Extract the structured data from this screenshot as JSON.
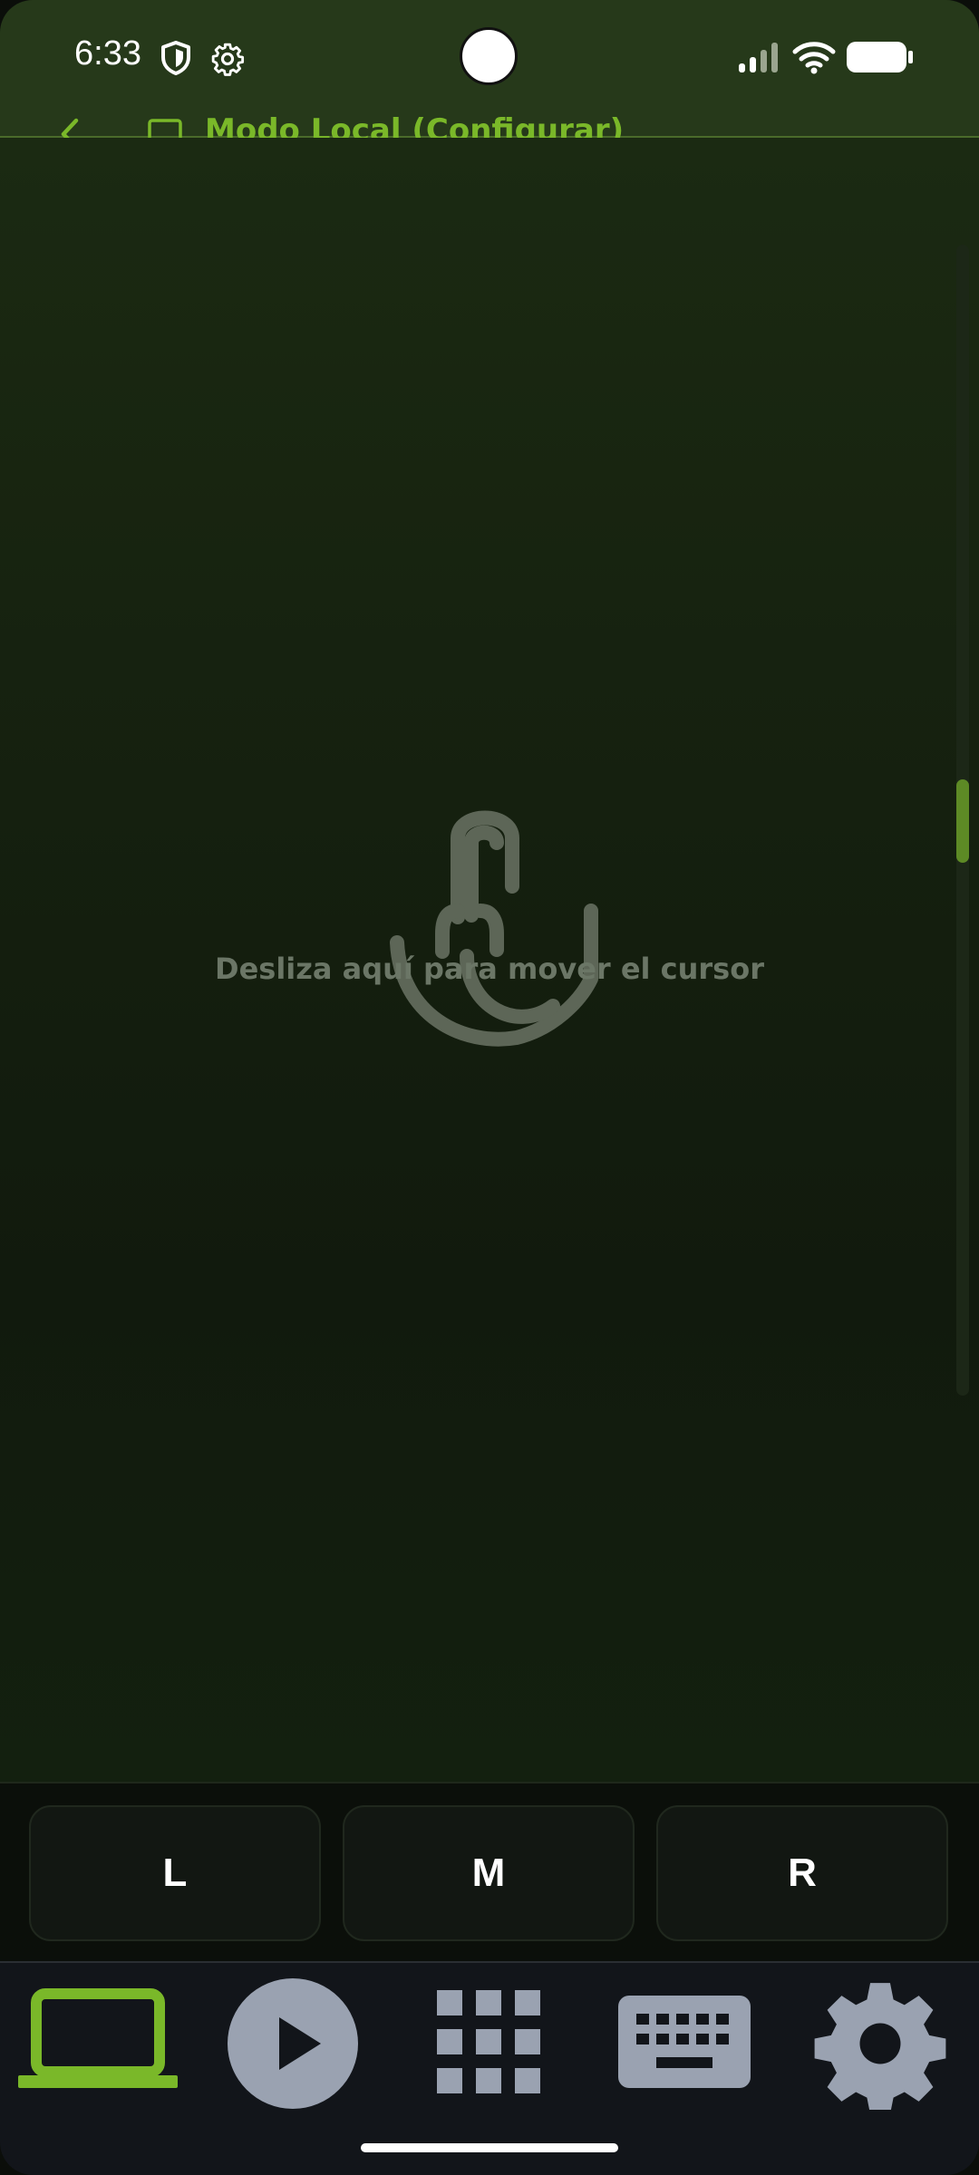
{
  "status_bar": {
    "time": "6:33",
    "icons": [
      "shield-icon",
      "gear-icon",
      "signal-icon",
      "wifi-icon",
      "battery-icon"
    ]
  },
  "header": {
    "back_icon": "chevron-left-icon",
    "mode_icon": "laptop-icon",
    "title": "Modo Local (Configurar)"
  },
  "touchpad": {
    "icon": "touch-gesture-icon",
    "hint": "Desliza aquí para mover el cursor"
  },
  "mouse_buttons": {
    "left": "L",
    "middle": "M",
    "right": "R"
  },
  "bottom_nav": {
    "items": [
      {
        "icon": "laptop-icon",
        "active": true
      },
      {
        "icon": "play-icon",
        "active": false
      },
      {
        "icon": "apps-grid-icon",
        "active": false
      },
      {
        "icon": "keyboard-icon",
        "active": false
      },
      {
        "icon": "settings-icon",
        "active": false
      }
    ]
  },
  "colors": {
    "accent": "#7ab829",
    "status_bar_bg": "#26391a",
    "inactive_icon": "#9aa2b1",
    "nav_bg": "#12151a"
  }
}
